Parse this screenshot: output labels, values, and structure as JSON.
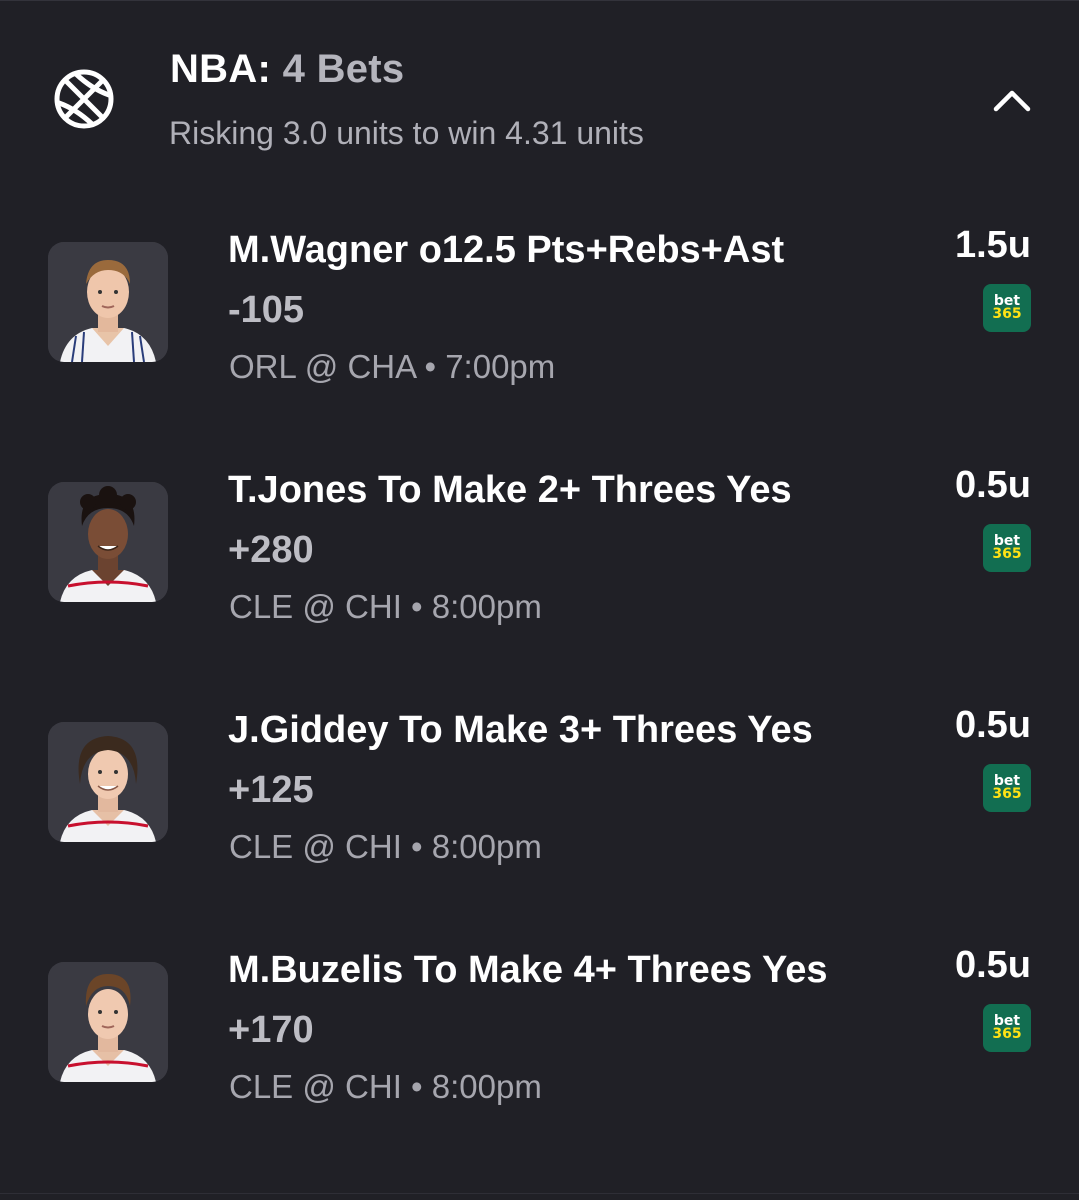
{
  "header": {
    "sport": "NBA:",
    "count": "4 Bets",
    "subtitle": "Risking 3.0 units to win 4.31 units",
    "icon": "basketball-icon",
    "collapse_icon": "chevron-up-icon"
  },
  "bets": [
    {
      "title": "M.Wagner o12.5 Pts+Rebs+Ast",
      "odds": "-105",
      "game": "ORL @ CHA • 7:00pm",
      "units": "1.5u",
      "book_line1": "bet",
      "book_line2": "365",
      "jersey": "white-pinstripe"
    },
    {
      "title": "T.Jones To Make 2+ Threes Yes",
      "odds": "+280",
      "game": "CLE @ CHI • 8:00pm",
      "units": "0.5u",
      "book_line1": "bet",
      "book_line2": "365",
      "jersey": "white-red"
    },
    {
      "title": "J.Giddey To Make 3+ Threes Yes",
      "odds": "+125",
      "game": "CLE @ CHI • 8:00pm",
      "units": "0.5u",
      "book_line1": "bet",
      "book_line2": "365",
      "jersey": "white-red"
    },
    {
      "title": "M.Buzelis To Make 4+ Threes Yes",
      "odds": "+170",
      "game": "CLE @ CHI • 8:00pm",
      "units": "0.5u",
      "book_line1": "bet",
      "book_line2": "365",
      "jersey": "white-red"
    }
  ],
  "colors": {
    "background": "#202026",
    "muted_text": "#a6a6ae",
    "bet365_green": "#126e51",
    "bet365_yellow": "#ffe115"
  }
}
